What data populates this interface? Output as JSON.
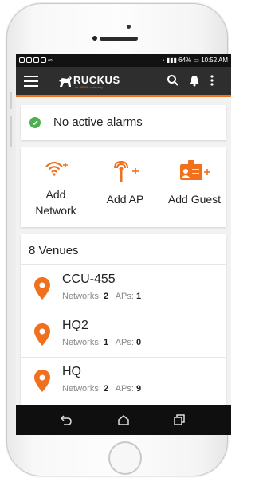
{
  "status_bar": {
    "battery": "64%",
    "time": "10:52 AM"
  },
  "app_bar": {
    "brand": "RUCKUS",
    "tagline": "an ARRIS company"
  },
  "alarms": {
    "text": "No active alarms",
    "status_color": "#4caf50"
  },
  "quick_actions": [
    {
      "label_line1": "Add",
      "label_line2": "Network"
    },
    {
      "label_line1": "Add AP",
      "label_line2": ""
    },
    {
      "label_line1": "Add Guest",
      "label_line2": ""
    }
  ],
  "venues": {
    "title": "8 Venues",
    "networks_label": "Networks:",
    "aps_label": "APs:",
    "items": [
      {
        "name": "CCU-455",
        "networks": "2",
        "aps": "1"
      },
      {
        "name": "HQ2",
        "networks": "1",
        "aps": "0"
      },
      {
        "name": "HQ",
        "networks": "2",
        "aps": "9"
      }
    ]
  },
  "colors": {
    "accent": "#f0701e",
    "appbar": "#2e2e2e"
  }
}
